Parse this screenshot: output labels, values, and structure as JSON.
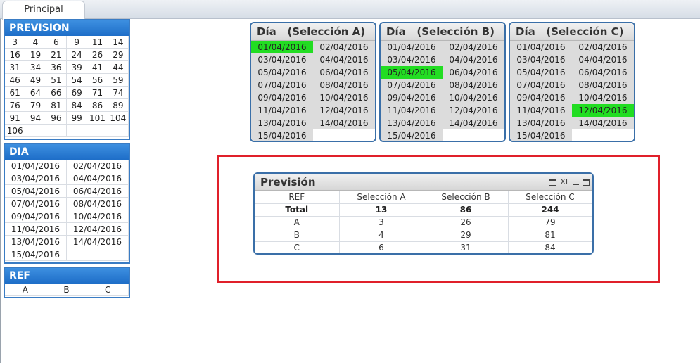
{
  "tabs": [
    {
      "label": "Principal",
      "active": true
    }
  ],
  "prevision": {
    "title": "PREVISION",
    "values": [
      "3",
      "4",
      "6",
      "9",
      "11",
      "14",
      "16",
      "19",
      "21",
      "24",
      "26",
      "29",
      "31",
      "34",
      "36",
      "39",
      "41",
      "44",
      "46",
      "49",
      "51",
      "54",
      "56",
      "59",
      "61",
      "64",
      "66",
      "69",
      "71",
      "74",
      "76",
      "79",
      "81",
      "84",
      "86",
      "89",
      "91",
      "94",
      "96",
      "99",
      "101",
      "104",
      "106"
    ]
  },
  "dia": {
    "title": "DIA",
    "values": [
      "01/04/2016",
      "02/04/2016",
      "03/04/2016",
      "04/04/2016",
      "05/04/2016",
      "06/04/2016",
      "07/04/2016",
      "08/04/2016",
      "09/04/2016",
      "10/04/2016",
      "11/04/2016",
      "12/04/2016",
      "13/04/2016",
      "14/04/2016",
      "15/04/2016"
    ]
  },
  "ref": {
    "title": "REF",
    "values": [
      "A",
      "B",
      "C"
    ]
  },
  "dia_boxes": [
    {
      "title": "Día   (Selección A)",
      "selected": "01/04/2016"
    },
    {
      "title": "Día   (Selección B)",
      "selected": "05/04/2016"
    },
    {
      "title": "Día   (Selección C)",
      "selected": "12/04/2016"
    }
  ],
  "dates": [
    "01/04/2016",
    "02/04/2016",
    "03/04/2016",
    "04/04/2016",
    "05/04/2016",
    "06/04/2016",
    "07/04/2016",
    "08/04/2016",
    "09/04/2016",
    "10/04/2016",
    "11/04/2016",
    "12/04/2016",
    "13/04/2016",
    "14/04/2016",
    "15/04/2016"
  ],
  "prevision_table": {
    "title": "Previsión",
    "icons": {
      "print": "print-icon",
      "xl_label": "XL",
      "minimize": "minimize-icon",
      "maximize": "maximize-icon"
    },
    "headers": [
      "REF",
      "Selección A",
      "Selección B",
      "Selección C"
    ],
    "total": [
      "Total",
      "13",
      "86",
      "244"
    ],
    "rows": [
      [
        "A",
        "3",
        "26",
        "79"
      ],
      [
        "B",
        "4",
        "29",
        "81"
      ],
      [
        "C",
        "6",
        "31",
        "84"
      ]
    ]
  },
  "colors": {
    "selected_green": "#22dd22",
    "listbox_header_blue": "#1e6ec8",
    "highlight_frame_red": "#e0202a"
  }
}
